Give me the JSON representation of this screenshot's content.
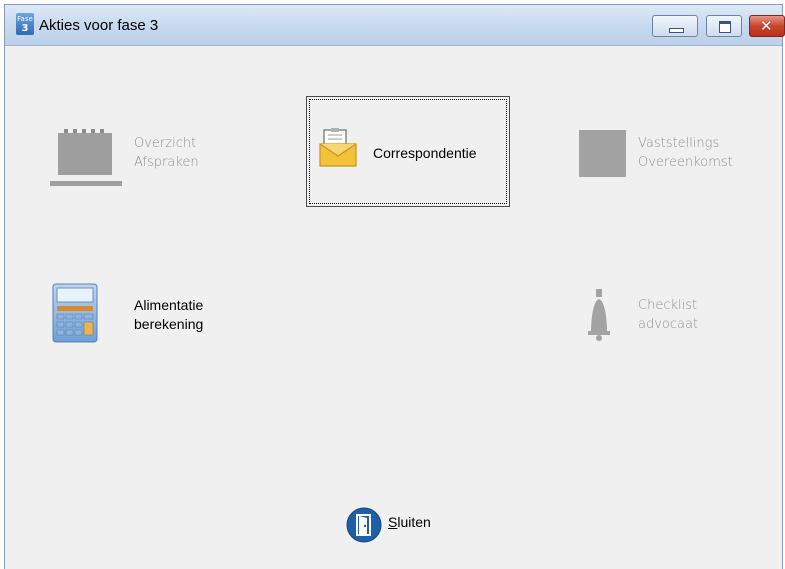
{
  "window": {
    "title": "Akties voor fase 3",
    "app_icon": {
      "line1": "Fase",
      "line2": "3"
    },
    "controls": {
      "minimize": "minimize-icon",
      "maximize": "maximize-icon",
      "close": "close-icon"
    }
  },
  "actions": {
    "overzicht": {
      "line1": "Overzicht",
      "line2": "Afspraken",
      "enabled": false,
      "icon": "calendar-icon"
    },
    "correspondentie": {
      "label": "Correspondentie",
      "enabled": true,
      "focused": true,
      "icon": "envelope-icon"
    },
    "vaststellings": {
      "line1": "Vaststellings",
      "line2": "Overeenkomst",
      "enabled": false,
      "icon": "document-icon"
    },
    "alimentatie": {
      "line1": "Alimentatie",
      "line2": "berekening",
      "enabled": true,
      "icon": "calculator-icon"
    },
    "checklist": {
      "line1": "Checklist",
      "line2": "advocaat",
      "enabled": false,
      "icon": "bell-icon"
    }
  },
  "close_action": {
    "label_first": "S",
    "label_rest": "luiten",
    "icon": "exit-door-icon"
  },
  "colors": {
    "titlebar": "#c7d9ef",
    "window_bg": "#f0f0f0",
    "disabled_text": "#8f8f8f",
    "exit_icon": "#1f5fa8",
    "close_button": "#c8452d"
  }
}
